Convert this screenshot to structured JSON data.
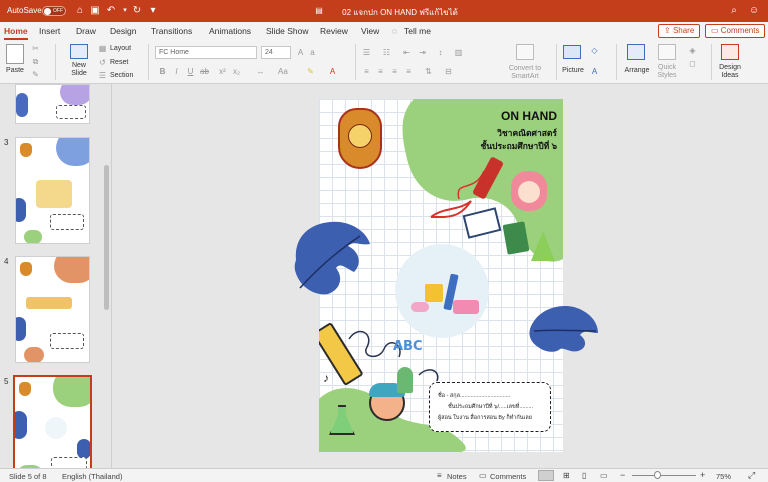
{
  "titlebar": {
    "autosave_label": "AutoSave",
    "autosave_state": "OFF",
    "document_title": "02 แจกปก ON HAND ฟรีแก้ไขได้"
  },
  "tabs": [
    {
      "label": "Home",
      "active": true
    },
    {
      "label": "Insert"
    },
    {
      "label": "Draw"
    },
    {
      "label": "Design"
    },
    {
      "label": "Transitions"
    },
    {
      "label": "Animations"
    },
    {
      "label": "Slide Show"
    },
    {
      "label": "Review"
    },
    {
      "label": "View"
    },
    {
      "label": "Tell me"
    }
  ],
  "share_label": "Share",
  "comments_label": "Comments",
  "ribbon": {
    "paste": "Paste",
    "new_slide": "New\nSlide",
    "layout": "Layout",
    "reset": "Reset",
    "section": "Section",
    "font_name": "FC Home",
    "font_size": "24",
    "convert_smartart": "Convert to\nSmartArt",
    "picture": "Picture",
    "arrange": "Arrange",
    "quick_styles": "Quick\nStyles",
    "design_ideas": "Design\nIdeas"
  },
  "thumbnails": [
    {
      "number": "3",
      "accent": "#7fa0df"
    },
    {
      "number": "4",
      "accent": "#e39466"
    },
    {
      "number": "5",
      "accent": "#9bd07c",
      "selected": true
    }
  ],
  "slide": {
    "title": "ON HAND",
    "subject": "วิชาคณิตศาสตร์",
    "grade": "ชั้นประถมศึกษาปีที่ ๖",
    "abc_text": "ABC",
    "form_line1": "ชื่อ - สกุล.................................",
    "form_line2": "ชั้นประถมศึกษาปีที่ ๖/.....เลขที่.........",
    "form_line3": "ผู้สอน ใบงาน สื่อการสอน By ก็ทำกันเลย"
  },
  "colors": {
    "accent": "#c43e1c",
    "blob_green": "#9bd07c",
    "leaf_blue": "#3d5fb0"
  },
  "statusbar": {
    "slide_count": "Slide 5 of 8",
    "language": "English (Thailand)",
    "notes": "Notes",
    "comments": "Comments",
    "zoom": "75%"
  }
}
